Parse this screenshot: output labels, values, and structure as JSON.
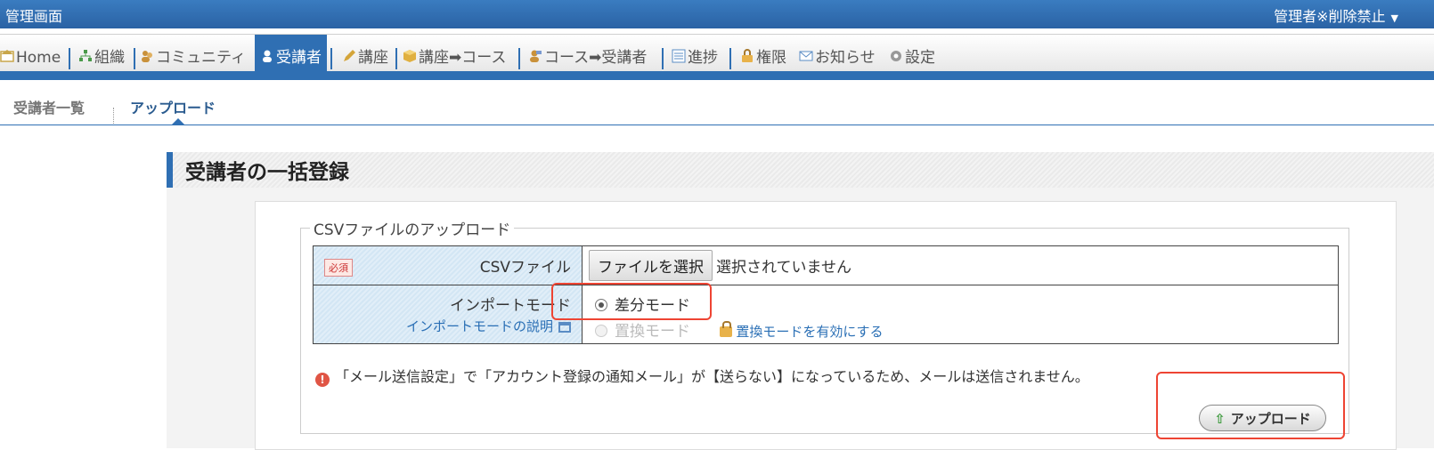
{
  "header": {
    "title": "管理画面",
    "user": "管理者※削除禁止"
  },
  "nav": [
    {
      "label": "Home",
      "icon": "home-icon",
      "color": "#c8a64a"
    },
    {
      "label": "組織",
      "icon": "organization-icon",
      "color": "#4a9a4a"
    },
    {
      "label": "コミュニティ",
      "icon": "community-icon",
      "color": "#c9913a"
    },
    {
      "label": "受講者",
      "icon": "student-icon",
      "color": "#ffffff",
      "active": true
    },
    {
      "label": "講座",
      "icon": "pencil-icon",
      "color": "#d4a53a"
    },
    {
      "label": "講座",
      "icon": "box-icon",
      "color": "#d4a53a"
    },
    {
      "label": "コース",
      "icon": "arrow-right-icon",
      "color": "#555555"
    },
    {
      "label": "コース",
      "icon": "course-student-icon",
      "color": "#c9913a"
    },
    {
      "label": "受講者",
      "icon": "arrow-right-icon",
      "color": "#555555"
    },
    {
      "label": "進捗",
      "icon": "progress-icon",
      "color": "#5a8cc4"
    },
    {
      "label": "権限",
      "icon": "lock-icon",
      "color": "#e8b24a"
    },
    {
      "label": "お知らせ",
      "icon": "mail-icon",
      "color": "#5a8cc4"
    },
    {
      "label": "設定",
      "icon": "gear-icon",
      "color": "#888888"
    }
  ],
  "subtabs": {
    "list": "受講者一覧",
    "upload": "アップロード"
  },
  "section_title": "受講者の一括登録",
  "form": {
    "legend": "CSVファイルのアップロード",
    "required_badge": "必須",
    "csv_label": "CSVファイル",
    "file_button": "ファイルを選択",
    "file_status": "選択されていません",
    "import_label": "インポートモード",
    "import_help": "インポートモードの説明",
    "mode_diff": "差分モード",
    "mode_replace": "置換モード",
    "enable_replace": "置換モードを有効にする"
  },
  "notice": "「メール送信設定」で「アカウント登録の通知メール」が【送らない】になっているため、メールは送信されません。",
  "upload_button": "アップロード",
  "accent": "#2f6fb3",
  "highlight": "#e43b2f"
}
